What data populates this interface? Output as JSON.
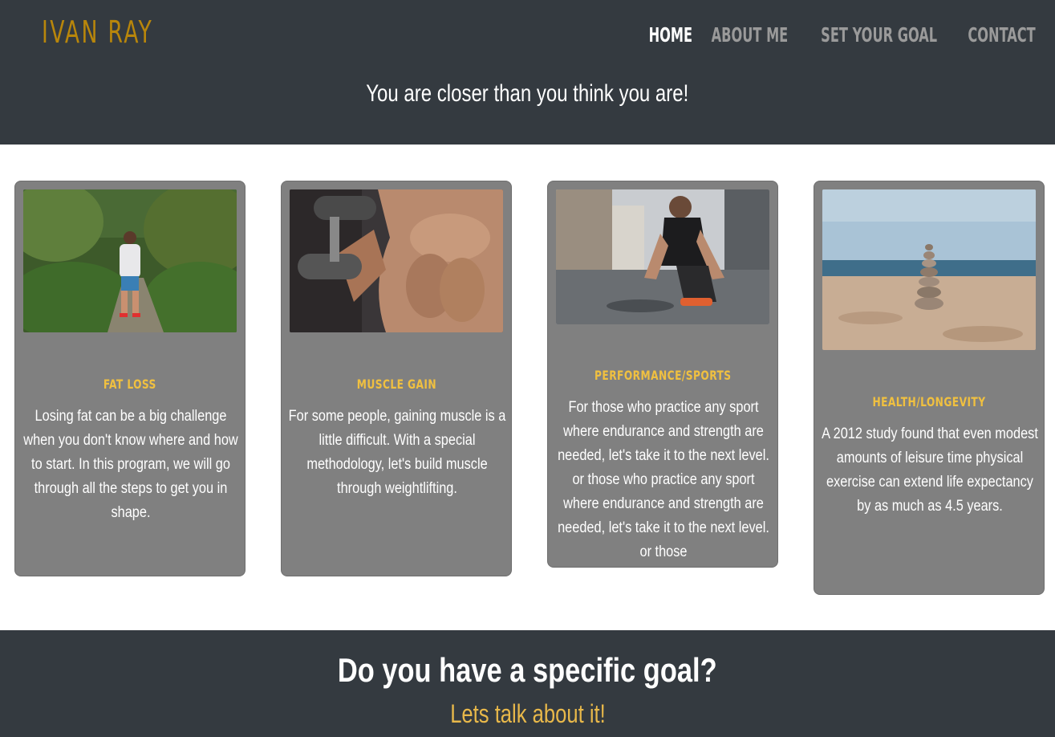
{
  "brand": {
    "name": "IVAN RAY",
    "color": "#b8860b"
  },
  "nav": {
    "items": [
      {
        "label": "HOME",
        "active": true
      },
      {
        "label": "ABOUT ME",
        "active": false
      },
      {
        "label": "SET YOUR GOAL",
        "active": false
      },
      {
        "label": "CONTACT",
        "active": false
      }
    ]
  },
  "hero": {
    "tagline": "You are closer than you think you are!"
  },
  "cards": [
    {
      "title": "FAT LOSS",
      "image_icon": "runner-forest-photo",
      "text": "Losing fat can be a big challenge when you don't know where and how to start. In this program, we will go through all the steps to get you in shape."
    },
    {
      "title": "MUSCLE GAIN",
      "image_icon": "dumbbell-curl-photo",
      "text": "For some people, gaining muscle is a little difficult. With a special methodology, let's build muscle through weightlifting."
    },
    {
      "title": "PERFORMANCE/SPORTS",
      "image_icon": "athlete-tying-shoe-photo",
      "text": "For those who practice any sport where endurance and strength are needed, let's take it to the next level. or those who practice any sport where endurance and strength are needed, let's take it to the next level. or those"
    },
    {
      "title": "HEALTH/LONGEVITY",
      "image_icon": "stacked-stones-beach-photo",
      "text": "A 2012 study found that even modest amounts of leisure time physical exercise can extend life expectancy by as much as 4.5 years."
    }
  ],
  "footer": {
    "question": "Do you have a specific goal?",
    "cta": "Lets talk about it!"
  },
  "colors": {
    "header_bg": "#343a40",
    "card_bg": "#808080",
    "card_title": "#f0c040",
    "cta": "#e8b84a"
  }
}
